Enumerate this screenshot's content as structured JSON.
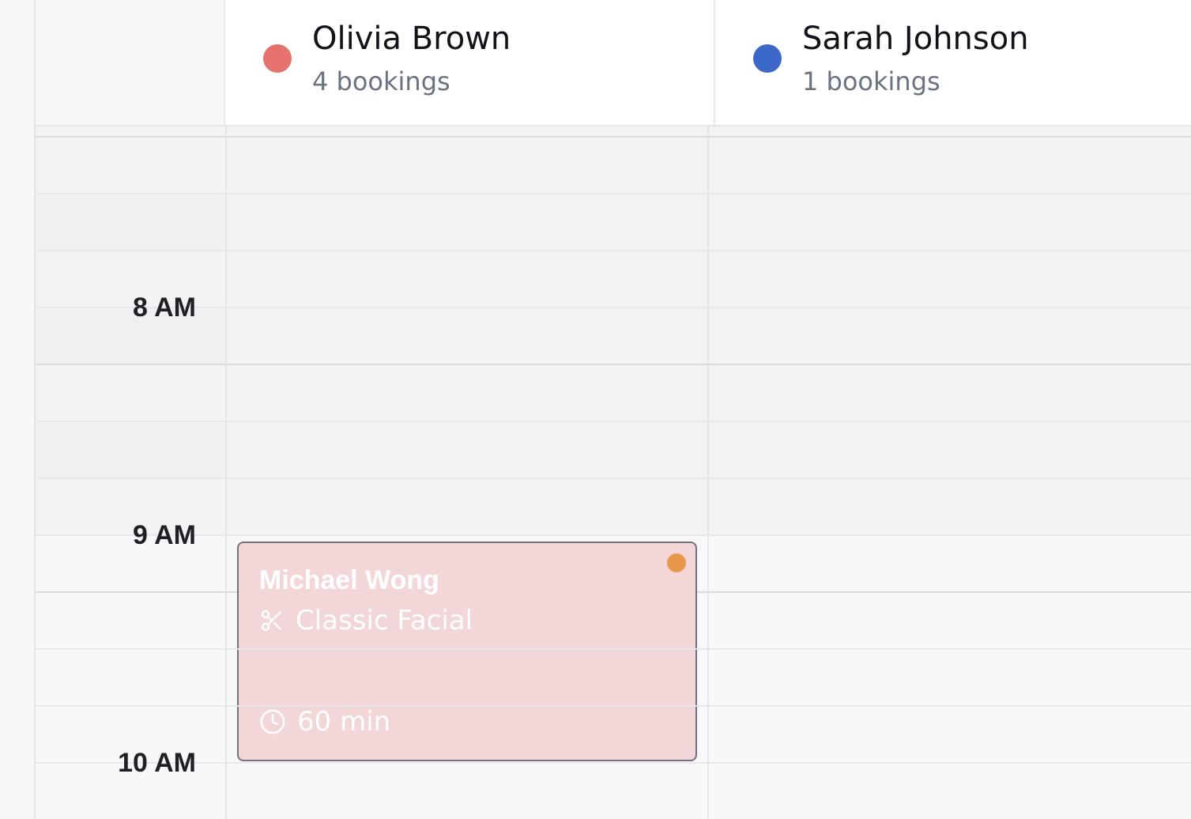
{
  "staff": [
    {
      "name": "Olivia Brown",
      "bookings_label": "4 bookings",
      "color": "#e5726c"
    },
    {
      "name": "Sarah Johnson",
      "bookings_label": "1 bookings",
      "color": "#3b68c9"
    }
  ],
  "time_labels": [
    "8 AM",
    "9 AM",
    "10 AM"
  ],
  "booking": {
    "client": "Michael Wong",
    "service": "Classic Facial",
    "duration": "60 min",
    "service_icon": "scissors-icon",
    "duration_icon": "clock-icon",
    "status_color": "#e8974a",
    "background_color": "#f3d6d8"
  }
}
